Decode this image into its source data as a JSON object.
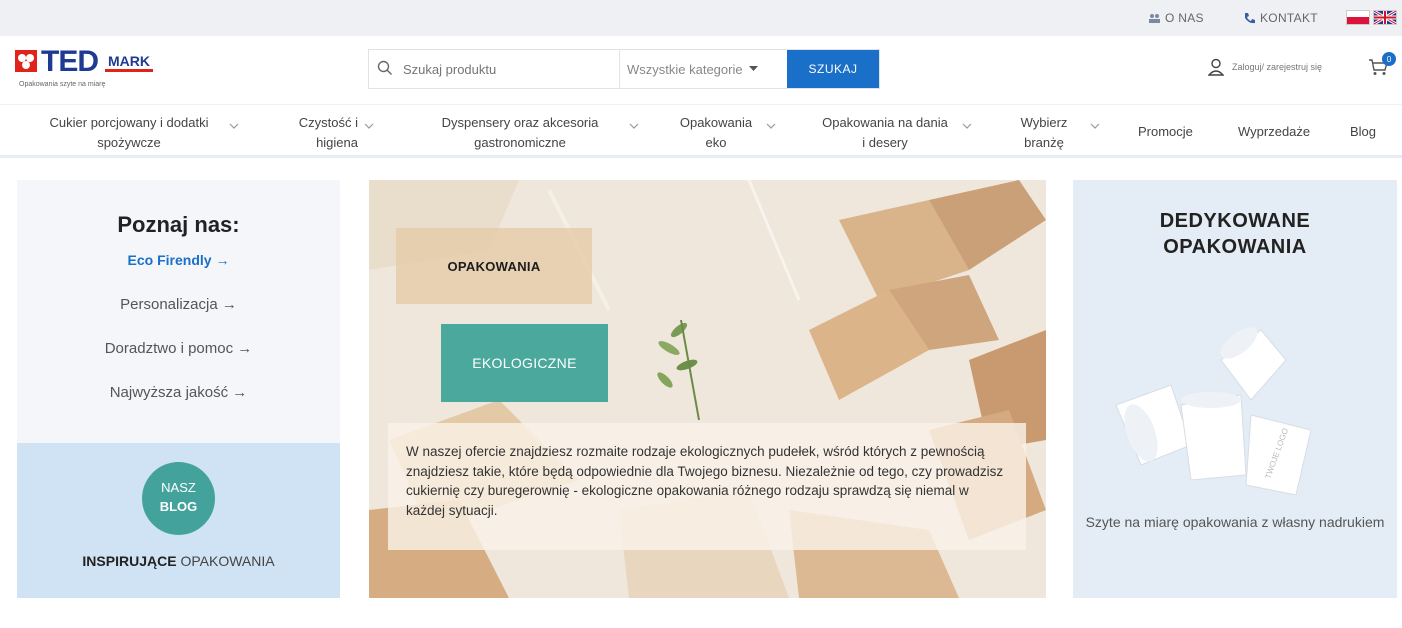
{
  "topbar": {
    "about": "O NAS",
    "contact": "KONTAKT"
  },
  "header": {
    "logo_main": "TED",
    "logo_secondary": "MARK",
    "logo_tagline": "Opakowania szyte na miarę",
    "search_placeholder": "Szukaj produktu",
    "category_select": "Wszystkie kategorie",
    "search_button": "SZUKAJ",
    "account_label": "Zaloguj/ zarejestruj się",
    "cart_count": "0"
  },
  "nav": {
    "items": [
      {
        "line1": "Cukier porcjowany i dodatki",
        "line2": "spożywcze"
      },
      {
        "line1": "Czystość i",
        "line2": "higiena"
      },
      {
        "line1": "Dyspensery oraz akcesoria",
        "line2": "gastronomiczne"
      },
      {
        "line1": "Opakowania",
        "line2": "eko"
      },
      {
        "line1": "Opakowania na dania",
        "line2": "i desery"
      },
      {
        "line1": "Wybierz",
        "line2": "branżę"
      }
    ],
    "promocje": "Promocje",
    "wyprzedaze": "Wyprzedaże",
    "blog": "Blog"
  },
  "left_panel": {
    "title": "Poznaj nas:",
    "links": [
      "Eco Firendly →",
      "Personalizacja →",
      "Doradztwo i pomoc →",
      "Najwyższa jakość →"
    ]
  },
  "blog_panel": {
    "circle_line1": "NASZ",
    "circle_line2": "BLOG",
    "title_bold": "INSPIRUJĄCE",
    "title_rest": " OPAKOWANIA"
  },
  "hero": {
    "label1": "OPAKOWANIA",
    "label2": "EKOLOGICZNE",
    "description": "W naszej ofercie znajdziesz rozmaite rodzaje ekologicznych pudełek, wśród których z pewnością znajdziesz takie, które będą odpowiednie dla Twojego biznesu. Niezależnie od tego, czy prowadzisz cukiernię czy buregerownię - ekologiczne opakowania różnego rodzaju sprawdzą się niemal w każdej sytuacji."
  },
  "right_panel": {
    "title_line1": "DEDYKOWANE",
    "title_line2": "OPAKOWANIA",
    "cup_logo": "TWOJE LOGO",
    "caption": "Szyte na miarę opakowania z własny nadrukiem"
  },
  "colors": {
    "brand_blue": "#1f3a93",
    "brand_red": "#e0241b",
    "accent_blue": "#1a6fc9",
    "teal": "#4aa89d"
  }
}
